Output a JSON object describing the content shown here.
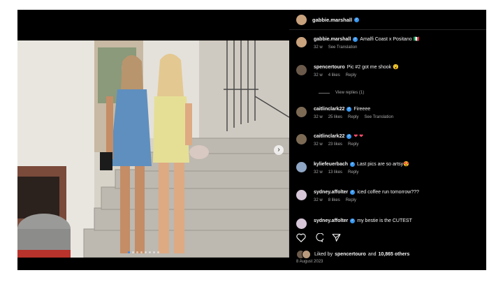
{
  "post": {
    "author": "gabbie.marshall",
    "colors": {
      "background": "#000000",
      "text": "#f5f5f5",
      "muted": "#a8a8a8",
      "verified": "#3897f0"
    }
  },
  "photo": {
    "slide_count": 8,
    "active_slide": 1,
    "next_icon": "chevron-right-icon"
  },
  "comments": [
    {
      "user": "gabbie.marshall",
      "verified": true,
      "text": "Amalfi Coast x Positano 🇮🇹",
      "time": "32 w",
      "likes": "",
      "actions": [
        "See Translation"
      ]
    },
    {
      "user": "spencertouro",
      "verified": false,
      "text": "Pic #2 got me shook 😮",
      "time": "32 w",
      "likes": "4 likes",
      "actions": [
        "Reply"
      ]
    },
    {
      "user": "caitlinclark22",
      "verified": true,
      "text": "Fireeee",
      "time": "32 w",
      "likes": "25 likes",
      "actions": [
        "Reply",
        "See Translation"
      ]
    },
    {
      "user": "caitlinclark22",
      "verified": true,
      "text": "❤ ❤",
      "time": "32 w",
      "likes": "23 likes",
      "actions": [
        "Reply"
      ]
    },
    {
      "user": "kyliefeuerbach",
      "verified": true,
      "text": "Last pics are so artsy😍",
      "time": "32 w",
      "likes": "13 likes",
      "actions": [
        "Reply"
      ]
    },
    {
      "user": "sydney.affolter",
      "verified": true,
      "text": "iced coffee run tomorrow???",
      "time": "32 w",
      "likes": "8 likes",
      "actions": [
        "Reply"
      ]
    },
    {
      "user": "sydney.affolter",
      "verified": true,
      "text": "my bestie is the CUTEST",
      "time": "",
      "likes": "",
      "actions": []
    }
  ],
  "view_replies": "View replies (1)",
  "likes_line": {
    "prefix": "Liked by",
    "user": "spencertouro",
    "middle": "and",
    "count": "10,865 others"
  },
  "date": "8 August 2023",
  "action_icons": [
    "heart-icon",
    "comment-icon",
    "share-icon"
  ]
}
